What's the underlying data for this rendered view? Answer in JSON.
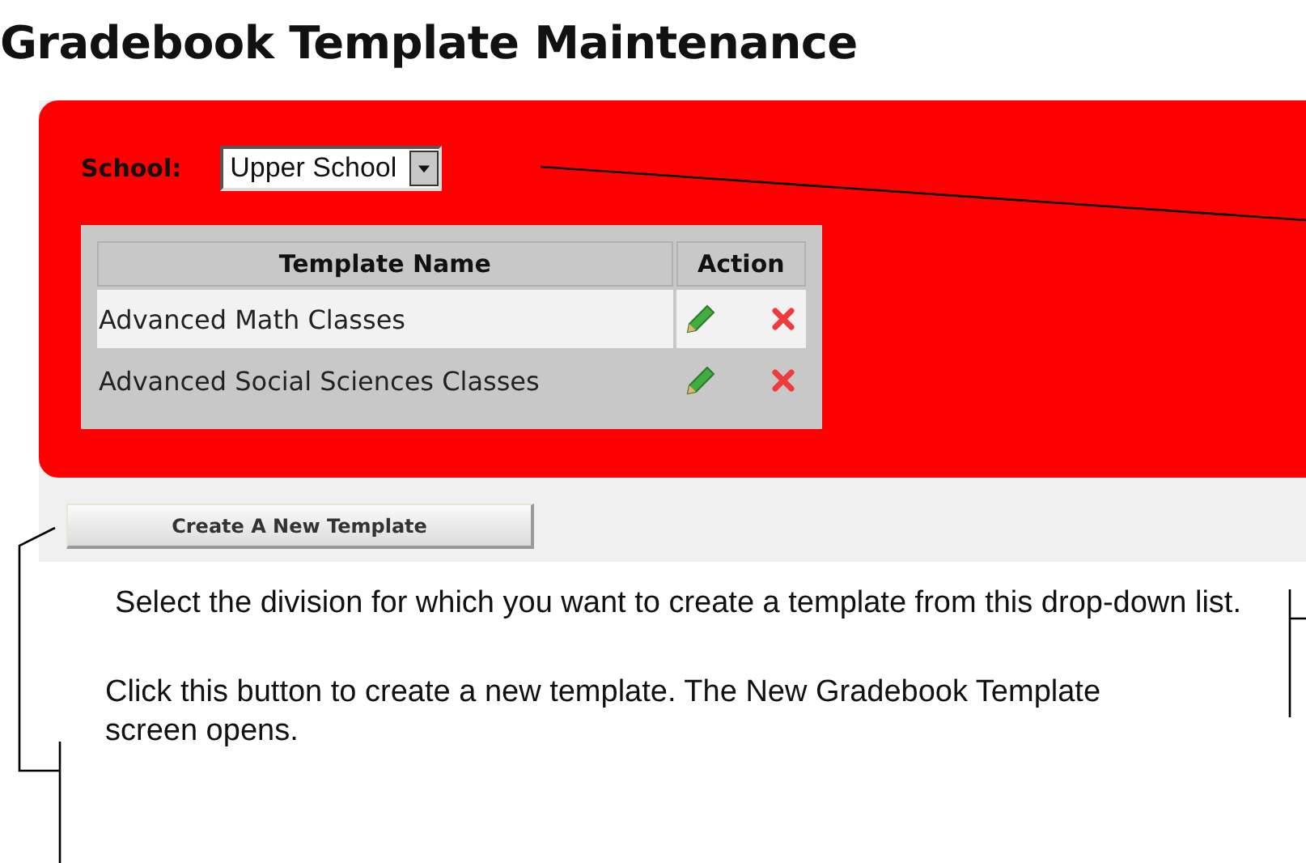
{
  "title": "Gradebook Template Maintenance",
  "school": {
    "label": "School:",
    "value": "Upper School"
  },
  "table": {
    "columns": [
      "Template Name",
      "Action"
    ],
    "rows": [
      {
        "name": "Advanced Math Classes"
      },
      {
        "name": "Advanced Social Sciences Classes"
      }
    ]
  },
  "create_button": "Create A New Template",
  "notes": [
    "Select the division for which you want to create a template from this drop-down list.",
    "Click this button to create a new template. The New Gradebook Template screen opens."
  ]
}
